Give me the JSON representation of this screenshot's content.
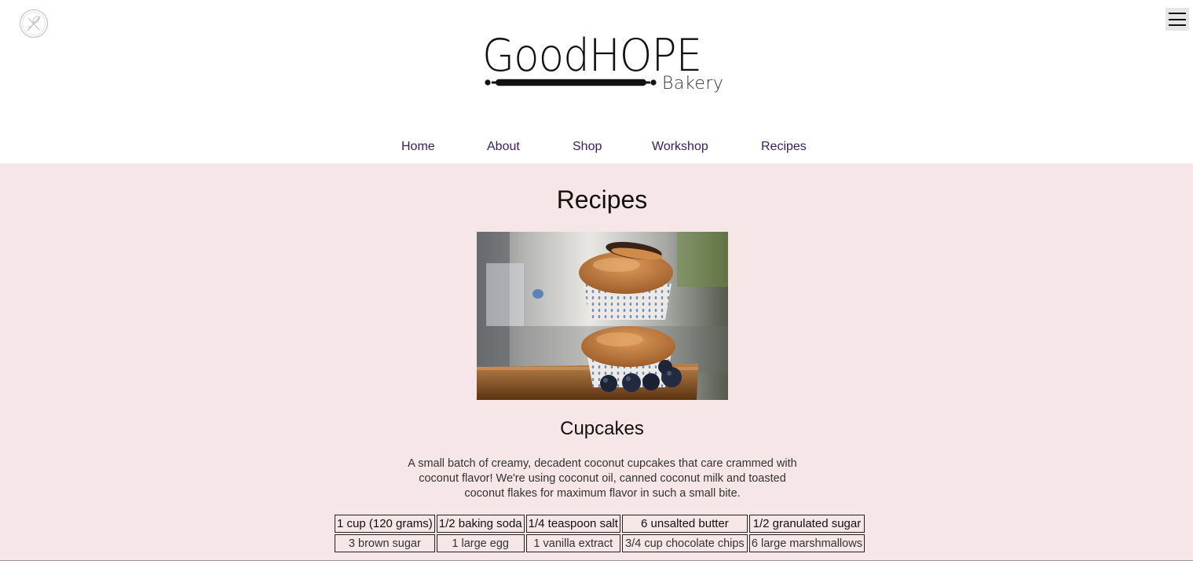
{
  "brand": {
    "name_main": "GoodHOPE",
    "name_sub": "Bakery"
  },
  "icons": {
    "corner": "bakery-whisk-logo-icon",
    "menu": "hamburger-menu-icon"
  },
  "nav": {
    "items": [
      "Home",
      "About",
      "Shop",
      "Workshop",
      "Recipes"
    ]
  },
  "page": {
    "title": "Recipes"
  },
  "recipe": {
    "title": "Cupcakes",
    "description": "A small batch of creamy, decadent coconut cupcakes that care crammed with coconut flavor! We're using coconut oil, canned coconut milk and toasted coconut flakes for maximum flavor in such a small bite.",
    "ingredients": [
      [
        "1 cup (120 grams)",
        "1/2 baking soda",
        "1/4 teaspoon salt",
        "6 unsalted butter",
        "1/2 granulated sugar"
      ],
      [
        "3 brown sugar",
        "1 large egg",
        "1 vanilla extract",
        "3/4 cup chocolate chips",
        "6 large marshmallows"
      ]
    ]
  },
  "colors": {
    "main_background": "#f6e6e7",
    "nav_link": "#3b1a5e",
    "header_background": "#ffffff"
  }
}
